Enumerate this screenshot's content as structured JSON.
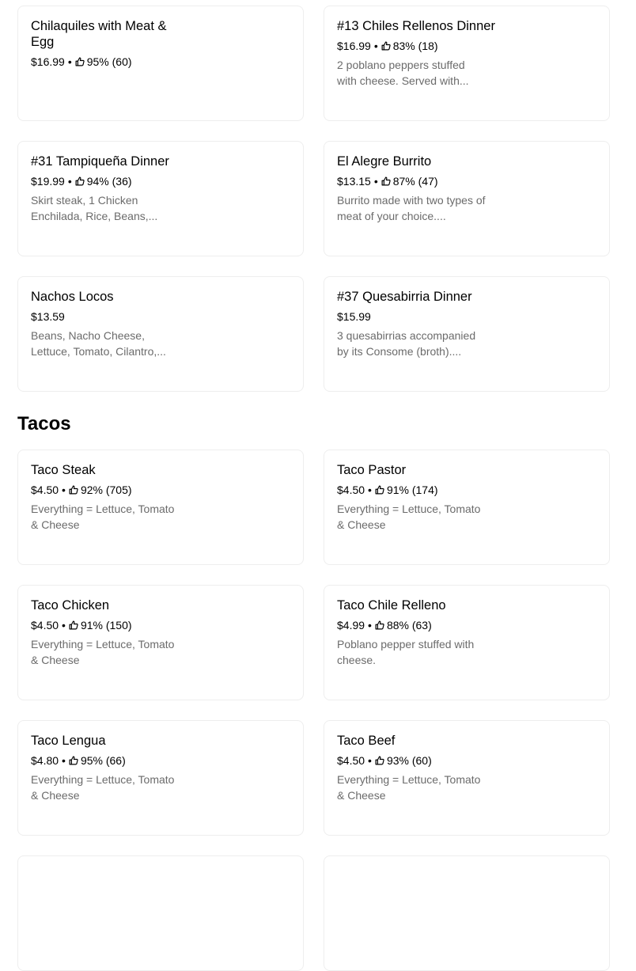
{
  "top_grid": [
    {
      "name": "Chilaquiles with Meat & Egg",
      "price": "$16.99",
      "rating": "95% (60)",
      "description": ""
    },
    {
      "name": "#13 Chiles Rellenos Dinner",
      "price": "$16.99",
      "rating": "83% (18)",
      "description": "2 poblano peppers stuffed with cheese. Served with..."
    },
    {
      "name": "#31 Tampiqueña Dinner",
      "price": "$19.99",
      "rating": "94% (36)",
      "description": "Skirt steak, 1 Chicken Enchilada, Rice, Beans,..."
    },
    {
      "name": "El Alegre Burrito",
      "price": "$13.15",
      "rating": "87% (47)",
      "description": "Burrito made with two types of meat of your choice...."
    },
    {
      "name": "Nachos Locos",
      "price": "$13.59",
      "rating": "",
      "description": "Beans, Nacho Cheese, Lettuce, Tomato, Cilantro,..."
    },
    {
      "name": "#37 Quesabirria Dinner",
      "price": "$15.99",
      "rating": "",
      "description": "3 quesabirrias accompanied by its Consome (broth)...."
    }
  ],
  "tacos_section": {
    "title": "Tacos",
    "items": [
      {
        "name": "Taco Steak",
        "price": "$4.50",
        "rating": "92% (705)",
        "description": "Everything = Lettuce, Tomato & Cheese"
      },
      {
        "name": "Taco Pastor",
        "price": "$4.50",
        "rating": "91% (174)",
        "description": "Everything = Lettuce, Tomato & Cheese"
      },
      {
        "name": "Taco Chicken",
        "price": "$4.50",
        "rating": "91% (150)",
        "description": "Everything = Lettuce, Tomato & Cheese"
      },
      {
        "name": "Taco Chile Relleno",
        "price": "$4.99",
        "rating": "88% (63)",
        "description": "Poblano pepper stuffed with cheese."
      },
      {
        "name": "Taco Lengua",
        "price": "$4.80",
        "rating": "95% (66)",
        "description": "Everything = Lettuce, Tomato & Cheese"
      },
      {
        "name": "Taco Beef",
        "price": "$4.50",
        "rating": "93% (60)",
        "description": "Everything = Lettuce, Tomato & Cheese"
      },
      {
        "name": "",
        "price": "",
        "rating": "",
        "description": ""
      },
      {
        "name": "",
        "price": "",
        "rating": "",
        "description": ""
      }
    ]
  },
  "icons": {
    "rating": "thumbs-up-icon"
  },
  "colors": {
    "text": "#000000",
    "muted": "#6b6b6b",
    "border": "#eeeeee",
    "background": "#ffffff"
  }
}
